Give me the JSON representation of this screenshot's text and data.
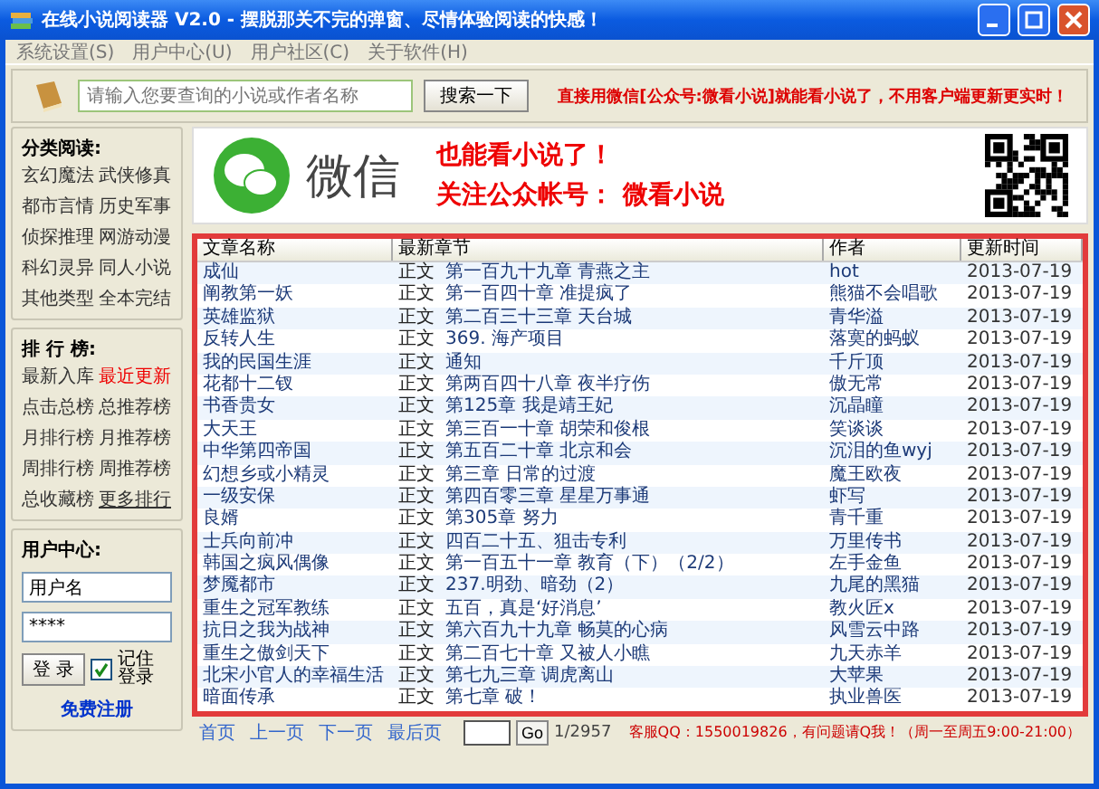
{
  "window": {
    "title": "在线小说阅读器 V2.0 - 摆脱那关不完的弹窗、尽情体验阅读的快感！"
  },
  "menu": [
    "系统设置(S)",
    "用户中心(U)",
    "用户社区(C)",
    "关于软件(H)"
  ],
  "search": {
    "placeholder": "请输入您要查询的小说或作者名称",
    "button": "搜索一下",
    "notice": "直接用微信[公众号:微看小说]就能看小说了，不用客户端更新更实时！"
  },
  "categories": {
    "title": "分类阅读:",
    "items": [
      {
        "label": "玄幻魔法",
        "selected": false
      },
      {
        "label": "武侠修真",
        "selected": false
      },
      {
        "label": "都市言情",
        "selected": false
      },
      {
        "label": "历史军事",
        "selected": false
      },
      {
        "label": "侦探推理",
        "selected": false
      },
      {
        "label": "网游动漫",
        "selected": false
      },
      {
        "label": "科幻灵异",
        "selected": false
      },
      {
        "label": "同人小说",
        "selected": false
      },
      {
        "label": "其他类型",
        "selected": false
      },
      {
        "label": "全本完结",
        "selected": false
      }
    ]
  },
  "rankings": {
    "title": "排 行 榜:",
    "items": [
      {
        "label": "最新入库",
        "selected": false,
        "kind": "plain"
      },
      {
        "label": "最近更新",
        "selected": true,
        "kind": "plain"
      },
      {
        "label": "点击总榜",
        "selected": false,
        "kind": "plain"
      },
      {
        "label": "总推荐榜",
        "selected": false,
        "kind": "plain"
      },
      {
        "label": "月排行榜",
        "selected": false,
        "kind": "plain"
      },
      {
        "label": "月推荐榜",
        "selected": false,
        "kind": "plain"
      },
      {
        "label": "周排行榜",
        "selected": false,
        "kind": "plain"
      },
      {
        "label": "周推荐榜",
        "selected": false,
        "kind": "plain"
      },
      {
        "label": "总收藏榜",
        "selected": false,
        "kind": "plain"
      },
      {
        "label": "更多排行",
        "selected": false,
        "kind": "more"
      }
    ]
  },
  "user": {
    "title": "用户中心:",
    "username": "用户名",
    "password": "****",
    "login": "登 录",
    "remember": {
      "label": "记住登录",
      "checked": true
    },
    "register": "免费注册"
  },
  "banner": {
    "brand": "微信",
    "line1": "也能看小说了！",
    "line2": "关注公众帐号： 微看小说"
  },
  "table": {
    "columns": [
      "文章名称",
      "最新章节",
      "作者",
      "更新时间"
    ],
    "rows": [
      {
        "name": "成仙",
        "volume": "正文",
        "chapter": "第一百九十九章 青燕之主",
        "author": "hot",
        "date": "2013-07-19"
      },
      {
        "name": "阐教第一妖",
        "volume": "正文",
        "chapter": "第一百四十章 准提疯了",
        "author": "熊猫不会唱歌",
        "date": "2013-07-19"
      },
      {
        "name": "英雄监狱",
        "volume": "正文",
        "chapter": "第二百三十三章 天台城",
        "author": "青华溢",
        "date": "2013-07-19"
      },
      {
        "name": "反转人生",
        "volume": "正文",
        "chapter": "369. 海产项目",
        "author": "落寞的蚂蚁",
        "date": "2013-07-19"
      },
      {
        "name": "我的民国生涯",
        "volume": "正文",
        "chapter": "通知",
        "author": "千斤顶",
        "date": "2013-07-19"
      },
      {
        "name": "花都十二钗",
        "volume": "正文",
        "chapter": "第两百四十八章 夜半疗伤",
        "author": "傲无常",
        "date": "2013-07-19"
      },
      {
        "name": "书香贵女",
        "volume": "正文",
        "chapter": "第125章 我是靖王妃",
        "author": "沉晶瞳",
        "date": "2013-07-19"
      },
      {
        "name": "大天王",
        "volume": "正文",
        "chapter": "第三百一十章 胡荣和俊根",
        "author": "笑谈谈",
        "date": "2013-07-19"
      },
      {
        "name": "中华第四帝国",
        "volume": "正文",
        "chapter": "第五百二十章 北京和会",
        "author": "沉泪的鱼wyj",
        "date": "2013-07-19"
      },
      {
        "name": "幻想乡或小精灵",
        "volume": "正文",
        "chapter": "第三章 日常的过渡",
        "author": "魔王欧夜",
        "date": "2013-07-19"
      },
      {
        "name": "一级安保",
        "volume": "正文",
        "chapter": "第四百零三章 星星万事通",
        "author": "虾写",
        "date": "2013-07-19"
      },
      {
        "name": "良婿",
        "volume": "正文",
        "chapter": "第305章 努力",
        "author": "青千重",
        "date": "2013-07-19"
      },
      {
        "name": "士兵向前冲",
        "volume": "正文",
        "chapter": "四百二十五、狙击专利",
        "author": "万里传书",
        "date": "2013-07-19"
      },
      {
        "name": "韩国之疯风偶像",
        "volume": "正文",
        "chapter": "第一百五十一章 教育（下）（2/2）",
        "author": "左手金鱼",
        "date": "2013-07-19"
      },
      {
        "name": "梦魇都市",
        "volume": "正文",
        "chapter": "237.明劲、暗劲（2）",
        "author": "九尾的黑猫",
        "date": "2013-07-19"
      },
      {
        "name": "重生之冠军教练",
        "volume": "正文",
        "chapter": "五百，真是‘好消息’",
        "author": "教火匠x",
        "date": "2013-07-19"
      },
      {
        "name": "抗日之我为战神",
        "volume": "正文",
        "chapter": "第六百九十九章 畅莫的心病",
        "author": "风雪云中路",
        "date": "2013-07-19"
      },
      {
        "name": "重生之傲剑天下",
        "volume": "正文",
        "chapter": "第二百七十章 又被人小瞧",
        "author": "九天赤羊",
        "date": "2013-07-19"
      },
      {
        "name": "北宋小官人的幸福生活",
        "volume": "正文",
        "chapter": "第七九三章 调虎离山",
        "author": "大苹果",
        "date": "2013-07-19"
      },
      {
        "name": "暗面传承",
        "volume": "正文",
        "chapter": "第七章 破！",
        "author": "执业兽医",
        "date": "2013-07-19"
      }
    ]
  },
  "pager": {
    "links": [
      "首页",
      "上一页",
      "下一页",
      "最后页"
    ],
    "go": "Go",
    "pages": "1/2957"
  },
  "footer": "客服QQ：1550019826，有问题请Q我！（周一至周五9:00-21:00）"
}
